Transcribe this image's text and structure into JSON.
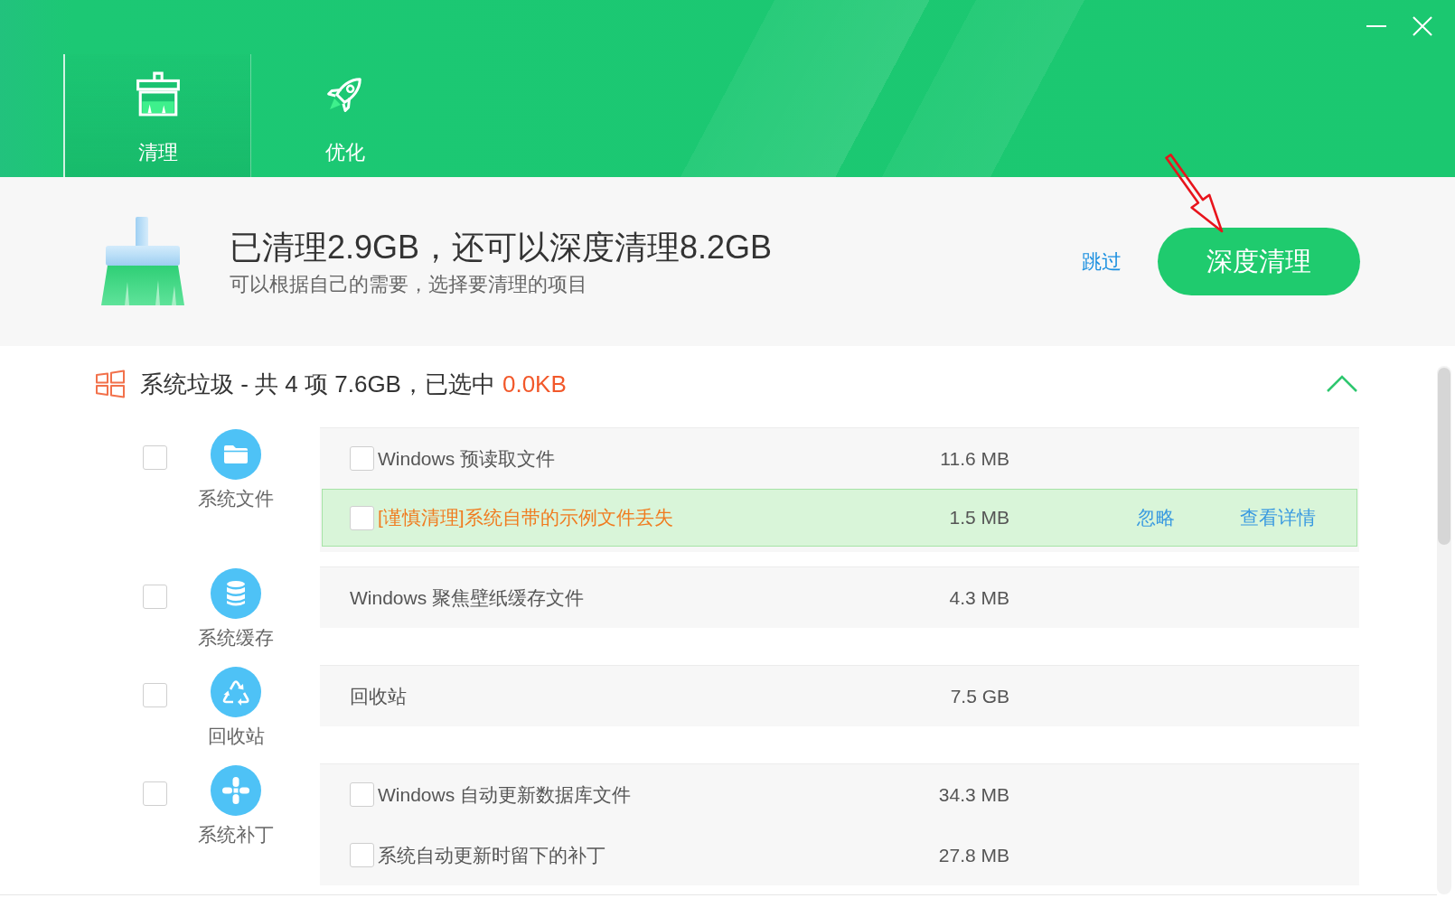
{
  "tabs": [
    {
      "label": "清理",
      "selected": true
    },
    {
      "label": "优化",
      "selected": false
    }
  ],
  "summary": {
    "title": "已清理2.9GB，还可以深度清理8.2GB",
    "subtitle": "可以根据自己的需要，选择要清理的项目",
    "skip_link": "跳过",
    "primary_button": "深度清理"
  },
  "section": {
    "title": "系统垃圾 - 共 4 项 7.6GB，已选中",
    "selected_size": "0.0KB",
    "expanded": true
  },
  "groups": [
    {
      "label": "系统文件",
      "checked": false,
      "items": [
        {
          "kind": "check",
          "name": "Windows 预读取文件",
          "size": "11.6 MB",
          "checked": false
        },
        {
          "kind": "caution",
          "name": "[谨慎清理]系统自带的示例文件丢失",
          "size": "1.5 MB",
          "checked": false,
          "actions": [
            "忽略",
            "查看详情"
          ]
        }
      ]
    },
    {
      "label": "系统缓存",
      "checked": false,
      "items": [
        {
          "kind": "plain",
          "name": "Windows 聚焦壁纸缓存文件",
          "size": "4.3 MB"
        }
      ]
    },
    {
      "label": "回收站",
      "checked": false,
      "items": [
        {
          "kind": "plain",
          "name": "回收站",
          "size": "7.5 GB"
        }
      ]
    },
    {
      "label": "系统补丁",
      "checked": false,
      "items": [
        {
          "kind": "check",
          "name": "Windows 自动更新数据库文件",
          "size": "34.3 MB",
          "checked": false
        },
        {
          "kind": "check",
          "name": "系统自动更新时留下的补丁",
          "size": "27.8 MB",
          "checked": false
        }
      ]
    }
  ]
}
